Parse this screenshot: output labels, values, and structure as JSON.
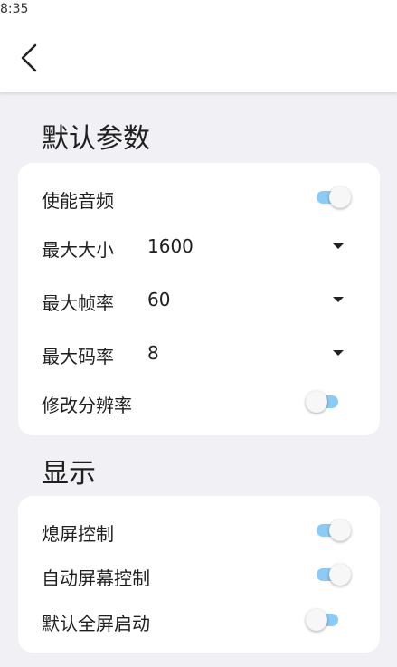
{
  "status_bar": {
    "time": "8:35"
  },
  "app_bar": {
    "back_icon": "chevron-left-icon"
  },
  "sections": {
    "defaults": {
      "title": "默认参数",
      "enable_audio": {
        "label": "使能音频",
        "on": true
      },
      "max_size": {
        "label": "最大大小",
        "value": "1600"
      },
      "max_fps": {
        "label": "最大帧率",
        "value": "60"
      },
      "max_bitrate": {
        "label": "最大码率",
        "value": "8"
      },
      "change_resolution": {
        "label": "修改分辨率",
        "on": false
      }
    },
    "display": {
      "title": "显示",
      "screen_off_control": {
        "label": "熄屏控制",
        "on": true
      },
      "auto_screen_control": {
        "label": "自动屏幕控制",
        "on": true
      },
      "default_fullscreen": {
        "label": "默认全屏启动",
        "on": false
      }
    }
  },
  "colors": {
    "accent_track": "#8ccbf7",
    "background": "#f1f0f5",
    "card": "#ffffff"
  }
}
